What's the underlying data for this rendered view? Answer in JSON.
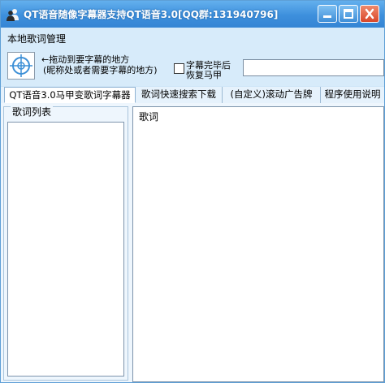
{
  "window": {
    "title": "QT语音随像字幕器支持QT语音3.0[QQ群:131940796]"
  },
  "menu": {
    "items": [
      "本地歌词管理"
    ]
  },
  "tool": {
    "drag_hint_line1": "←拖动到要字幕的地方",
    "drag_hint_line2": "(昵称处或者需要字幕的地方)",
    "checkbox_label_line1": "字幕完毕后",
    "checkbox_label_line2": "恢复马甲",
    "checkbox_checked": false,
    "input_value": ""
  },
  "tabs": [
    {
      "label": "QT语音3.0马甲变歌词字幕器",
      "active": true
    },
    {
      "label": "歌词快速搜索下载",
      "active": false
    },
    {
      "label": "(自定义)滚动广告牌",
      "active": false
    },
    {
      "label": "程序使用说明",
      "active": false
    }
  ],
  "panel": {
    "lyric_list_title": "歌词列表",
    "lyrics_label": "歌词"
  },
  "colors": {
    "titlebar": "#3d8fdc",
    "window_bg": "#cfe6f8",
    "close_button": "#d9472a"
  },
  "icons": {
    "app": "users-icon",
    "minimize": "minimize-icon",
    "maximize": "maximize-icon",
    "close": "close-icon",
    "crosshair": "crosshair-icon"
  }
}
